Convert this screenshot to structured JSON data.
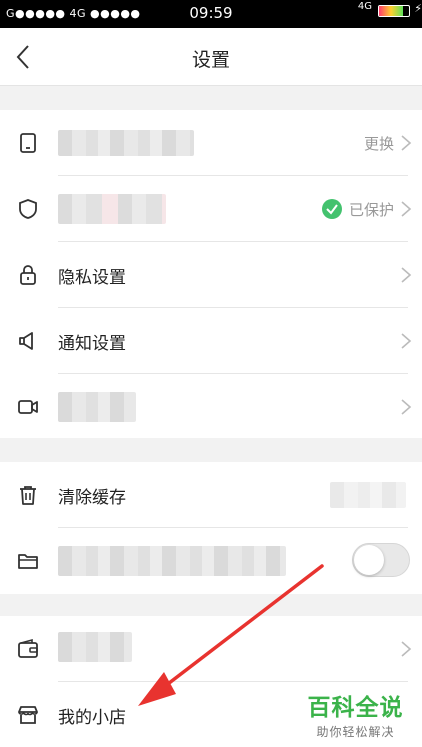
{
  "status_bar": {
    "carrier": "G●●●●● 4G ●●●●●",
    "time": "09:59",
    "network": "4G"
  },
  "header": {
    "title": "设置"
  },
  "settings": {
    "account_action": "更换",
    "protection_status": "已保护",
    "privacy_label": "隐私设置",
    "notification_label": "通知设置",
    "clear_cache_label": "清除缓存",
    "shop_label": "我的小店"
  },
  "watermark": {
    "title": "百科全说",
    "subtitle": "助你轻松解决"
  },
  "icons": [
    "back-arrow-icon",
    "phone-icon",
    "shield-icon",
    "lock-icon",
    "megaphone-icon",
    "video-icon",
    "trash-icon",
    "folder-icon",
    "wallet-icon",
    "shop-icon",
    "chevron-right-icon",
    "check-icon"
  ],
  "colors": {
    "accent_green": "#43c26e",
    "watermark_green": "#3bb34a",
    "arrow_red": "#e8332f"
  },
  "toggle": {
    "on": false
  }
}
